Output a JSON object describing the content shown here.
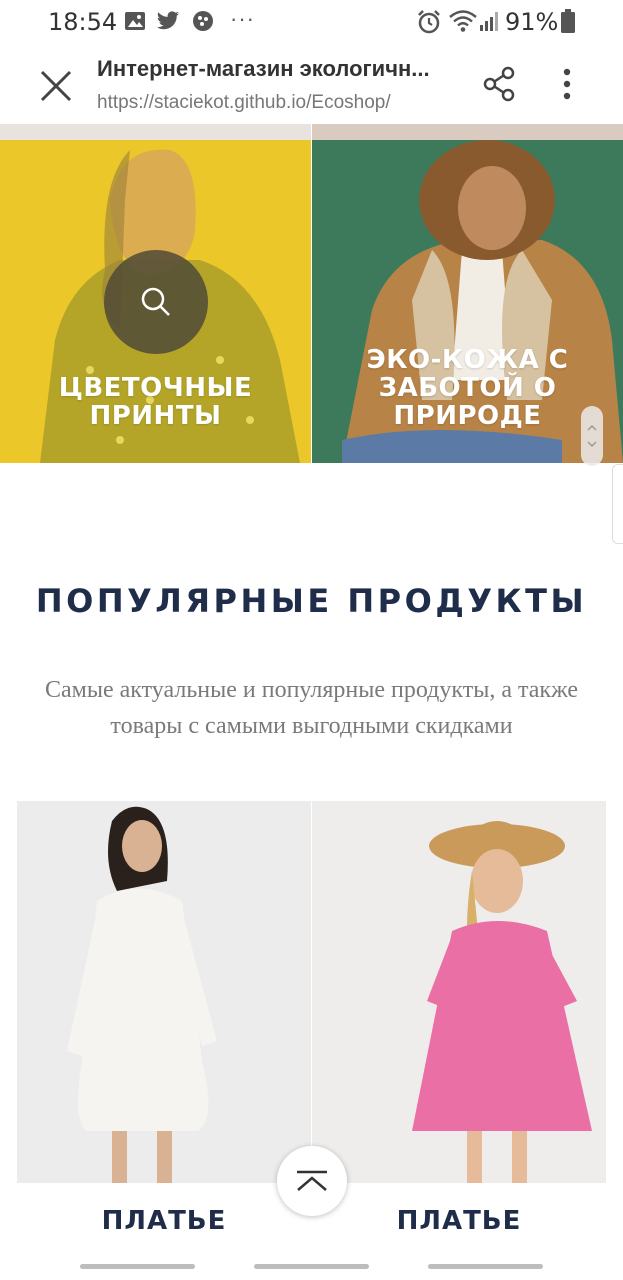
{
  "status_bar": {
    "time": "18:54",
    "notification_icons": [
      "gallery-icon",
      "twitter-icon",
      "app-icon"
    ],
    "more_indicator": "···",
    "system_icons": [
      "alarm-icon",
      "wifi-icon",
      "signal-icon"
    ],
    "battery_percent": "91%"
  },
  "browser": {
    "title": "Интернет-магазин экологичн...",
    "url": "https://staciekot.github.io/Ecoshop/"
  },
  "categories": [
    {
      "label": "ЦВЕТОЧНЫЕ ПРИНТЫ",
      "color": "#ecc72a"
    },
    {
      "label": "ЭКО-КОЖА С ЗАБОТОЙ О ПРИРОДЕ",
      "color": "#3d7a5c"
    }
  ],
  "popular": {
    "title": "ПОПУЛЯРНЫЕ ПРОДУКТЫ",
    "subtitle": "Самые актуальные и популярные продукты, а также товары с самыми выгодными скидками"
  },
  "products": [
    {
      "label": "ПЛАТЬЕ",
      "dress_color": "#f3f2ee"
    },
    {
      "label": "ПЛАТЬЕ",
      "dress_color": "#ea6fa5"
    }
  ],
  "colors": {
    "heading": "#1f2d4b",
    "subtitle": "#7a7a7a"
  }
}
